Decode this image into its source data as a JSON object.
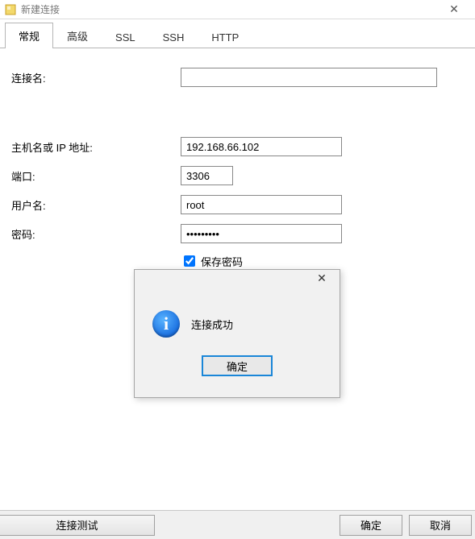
{
  "titlebar": {
    "title": "新建连接"
  },
  "tabs": {
    "items": [
      {
        "label": "常规",
        "active": true
      },
      {
        "label": "高级",
        "active": false
      },
      {
        "label": "SSL",
        "active": false
      },
      {
        "label": "SSH",
        "active": false
      },
      {
        "label": "HTTP",
        "active": false
      }
    ]
  },
  "form": {
    "conn_name_label": "连接名:",
    "conn_name_value": "",
    "host_label": "主机名或 IP 地址:",
    "host_value": "192.168.66.102",
    "port_label": "端口:",
    "port_value": "3306",
    "user_label": "用户名:",
    "user_value": "root",
    "pass_label": "密码:",
    "pass_value": "•••••••••",
    "savepass_label": "保存密码",
    "savepass_checked": true
  },
  "msgbox": {
    "text": "连接成功",
    "ok_label": "确定"
  },
  "bottom": {
    "test_label": "连接测试",
    "ok_label": "确定",
    "cancel_label": "取消"
  }
}
